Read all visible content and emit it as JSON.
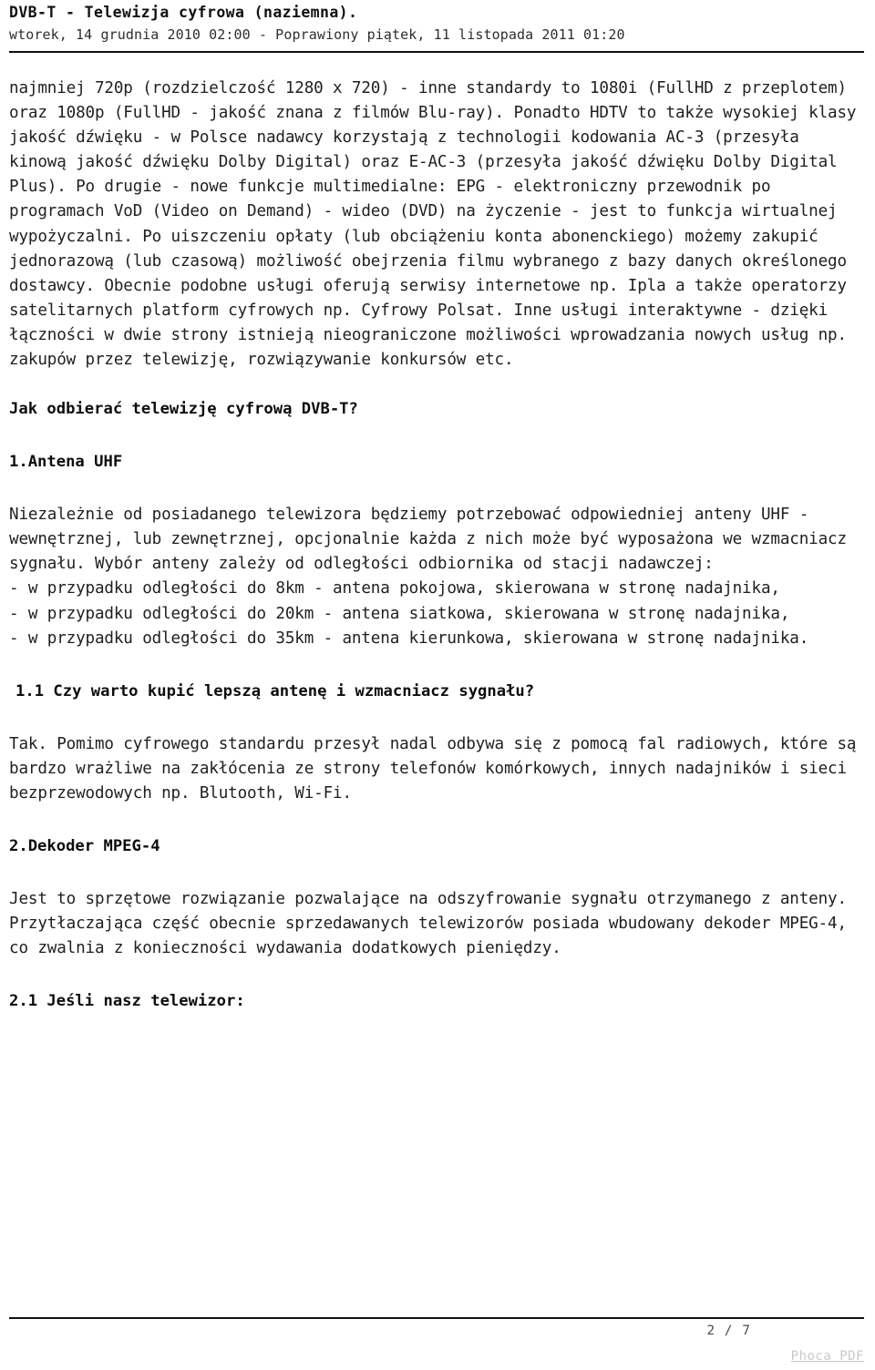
{
  "document": {
    "title": "DVB-T - Telewizja cyfrowa (naziemna).",
    "date_line": "wtorek, 14 grudnia 2010 02:00 - Poprawiony piątek, 11 listopada 2011 01:20"
  },
  "body": {
    "paragraph_1": "najmniej 720p (rozdzielczość 1280 x 720) - inne standardy to 1080i (FullHD z przeplotem) oraz 1080p (FullHD - jakość znana z filmów Blu-ray). Ponadto HDTV to także wysokiej klasy jakość dźwięku - w Polsce nadawcy korzystają z technologii kodowania AC-3 (przesyła kinową jakość dźwięku Dolby Digital) oraz E-AC-3 (przesyła jakość dźwięku Dolby Digital Plus). Po drugie - nowe funkcje multimedialne: EPG - elektroniczny przewodnik po programach VoD (Video on Demand) - wideo (DVD) na życzenie - jest to funkcja wirtualnej wypożyczalni. Po uiszczeniu opłaty (lub obciążeniu konta abonenckiego) możemy zakupić jednorazową (lub czasową) możliwość obejrzenia filmu wybranego z bazy danych określonego dostawcy. Obecnie podobne usługi oferują serwisy internetowe np. Ipla a także operatorzy satelitarnych platform cyfrowych np. Cyfrowy Polsat. Inne usługi interaktywne - dzięki łączności w dwie strony istnieją nieograniczone możliwości wprowadzania nowych usług np. zakupów przez telewizję, rozwiązywanie konkursów etc.",
    "heading_main": "Jak odbierać telewizję cyfrową DVB-T?",
    "heading_1": "1.Antena UHF",
    "paragraph_2": "Niezależnie od posiadanego telewizora będziemy potrzebować odpowiedniej anteny UHF - wewnętrznej, lub zewnętrznej, opcjonalnie każda z nich może być wyposażona we wzmacniacz sygnału. Wybór anteny zależy od odległości odbiornika od stacji nadawczej:",
    "list_item_1": "- w przypadku odległości do 8km - antena pokojowa, skierowana w stronę nadajnika,",
    "list_item_2": "- w przypadku odległości do 20km - antena siatkowa, skierowana w stronę nadajnika,",
    "list_item_3": "- w przypadku odległości do 35km - antena kierunkowa, skierowana w stronę nadajnika.",
    "heading_1_1": "1.1 Czy warto kupić lepszą antenę i wzmacniacz sygnału?",
    "paragraph_3": "Tak. Pomimo cyfrowego standardu przesył nadal odbywa się z pomocą fal radiowych, które są bardzo wrażliwe na zakłócenia ze strony telefonów komórkowych, innych nadajników i sieci bezprzewodowych np. Blutooth, Wi-Fi.",
    "heading_2": "2.Dekoder MPEG-4",
    "paragraph_4": "Jest to sprzętowe rozwiązanie pozwalające na odszyfrowanie sygnału otrzymanego z anteny. Przytłaczająca część obecnie sprzedawanych telewizorów posiada wbudowany dekoder MPEG-4, co zwalnia z konieczności wydawania dodatkowych pieniędzy.",
    "heading_2_1": "2.1 Jeśli nasz telewizor:"
  },
  "footer": {
    "page_number": "2 / 7",
    "generator_link": "Phoca PDF"
  }
}
